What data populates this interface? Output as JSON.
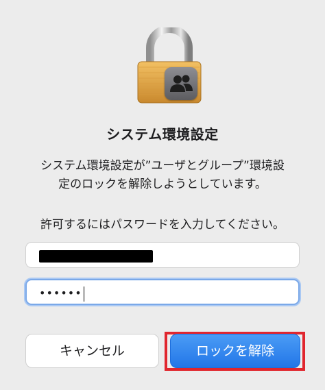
{
  "dialog": {
    "title": "システム環境設定",
    "message_line1": "システム環境設定が”ユーザとグループ”環境設",
    "message_line2": "定のロックを解除しようとしています。",
    "prompt": "許可するにはパスワードを入力してください。"
  },
  "icons": {
    "main": "padlock-icon",
    "badge": "users-icon"
  },
  "fields": {
    "username": {
      "value_redacted": true
    },
    "password": {
      "masked_value": "••••••"
    }
  },
  "buttons": {
    "cancel_label": "キャンセル",
    "unlock_label": "ロックを解除"
  },
  "colors": {
    "accent": "#2276e8",
    "highlight_frame": "#e0262e",
    "focus_ring": "#7aa8e8"
  }
}
